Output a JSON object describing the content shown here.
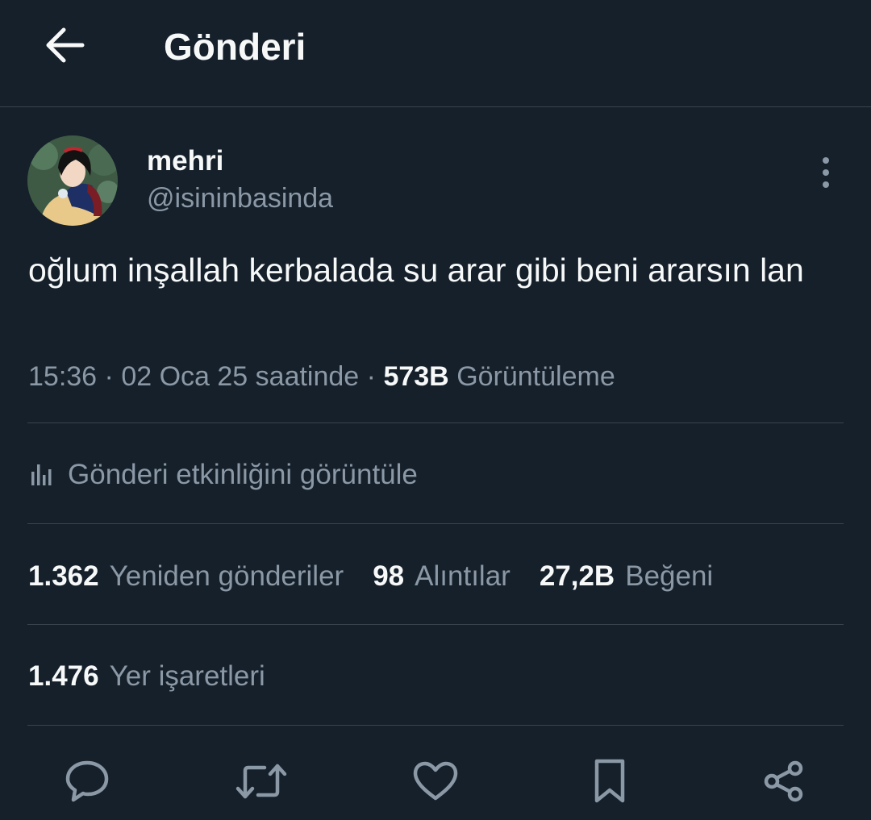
{
  "header": {
    "title": "Gönderi"
  },
  "author": {
    "name": "mehri",
    "handle": "@isininbasinda"
  },
  "tweet": {
    "text": "oğlum inşallah kerbalada su arar gibi beni ararsın lan",
    "time": "15:36",
    "date_text": "02 Oca 25 saatinde",
    "separator": "·",
    "views_count": "573B",
    "views_label": "Görüntüleme"
  },
  "activity": {
    "label": "Gönderi etkinliğini görüntüle"
  },
  "stats": {
    "retweets": {
      "count": "1.362",
      "label": "Yeniden gönderiler"
    },
    "quotes": {
      "count": "98",
      "label": "Alıntılar"
    },
    "likes": {
      "count": "27,2B",
      "label": "Beğeni"
    },
    "bookmarks": {
      "count": "1.476",
      "label": "Yer işaretleri"
    }
  },
  "colors": {
    "background": "#15202b",
    "text_primary": "#f7f9f9",
    "text_secondary": "#8b98a5",
    "divider": "#38444d"
  },
  "icons": {
    "back": "arrow-left-icon",
    "more": "more-vertical-icon",
    "activity": "bar-chart-icon",
    "reply": "reply-icon",
    "retweet": "retweet-icon",
    "like": "heart-icon",
    "bookmark": "bookmark-icon",
    "share": "share-icon"
  }
}
